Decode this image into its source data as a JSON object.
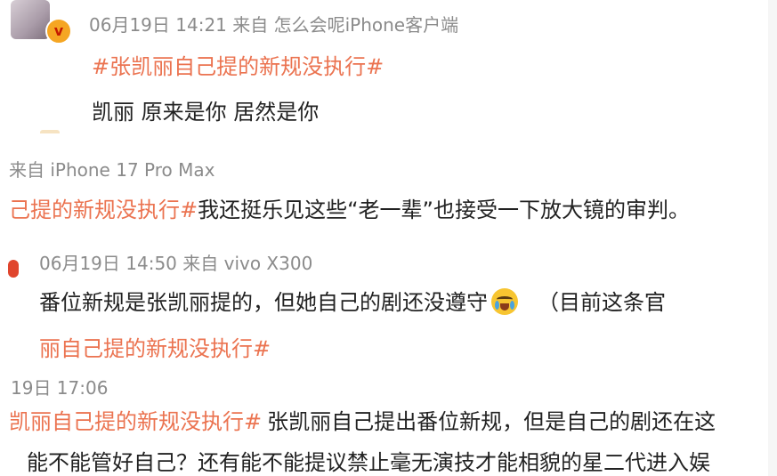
{
  "post1": {
    "meta": "06月19日 14:21 来自 怎么会呢iPhone客户端",
    "tag": "#张凯丽自己提的新规没执行#",
    "text": "凯丽 原来是你 居然是你"
  },
  "post2": {
    "meta": "来自 iPhone 17 Pro Max",
    "tag": "己提的新规没执行#",
    "text": "我还挺乐见这些“老一辈”也接受一下放大镜的审判。"
  },
  "post3": {
    "meta": "06月19日 14:50 来自 vivo X300",
    "text_before": "番位新规是张凯丽提的，但她自己的剧还没遵守",
    "emoji": "crying-face-icon",
    "text_after": "（目前这条官",
    "tag": "丽自己提的新规没执行#"
  },
  "post4": {
    "meta": "19日 17:06",
    "tag": "凯丽自己提的新规没执行#",
    "text": "张凯丽自己提出番位新规，但是自己的剧还在这",
    "text2": "能不能管好自己？还有能不能提议禁止毫无演技才能相貌的星二代进入娱"
  },
  "colors": {
    "tag": "#eb7350",
    "meta": "#8b8b8b",
    "text": "#222222"
  }
}
